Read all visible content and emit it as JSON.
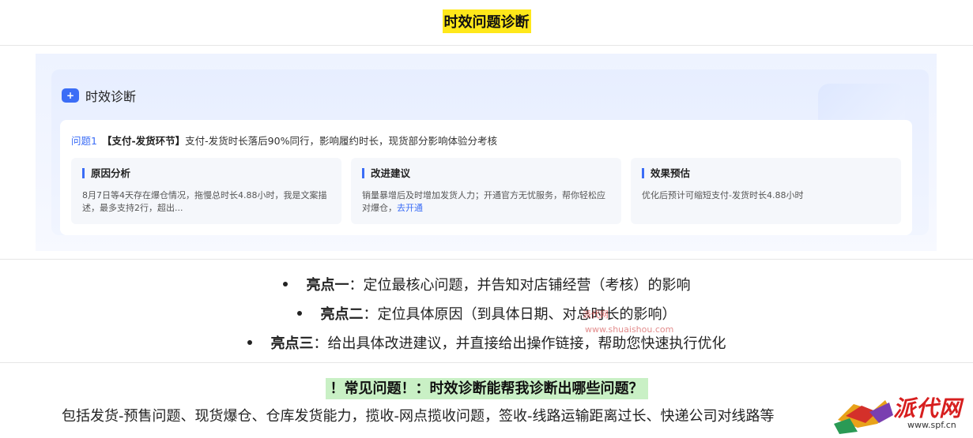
{
  "title": "时效问题诊断",
  "screenshot": {
    "card_title": "时效诊断",
    "card_icon": "+",
    "issue_number": "问题1",
    "issue_tag": "【支付-发货环节】",
    "issue_text": "支付-发货时长落后90%同行，影响履约时长，现货部分影响体验分考核",
    "cards": [
      {
        "title": "原因分析",
        "body": "8月7日等4天存在爆仓情况，拖慢总时长4.88小时，我是文案描述，最多支持2行，超出...",
        "link": ""
      },
      {
        "title": "改进建议",
        "body": "销量暴增后及时增加发货人力；开通官方无忧服务，帮你轻松应对爆仓，",
        "link": "去开通"
      },
      {
        "title": "效果预估",
        "body": "优化后预计可缩短支付-发货时长4.88小时",
        "link": ""
      }
    ]
  },
  "highlights": [
    {
      "label": "亮点一",
      "text": "：定位最核心问题，并告知对店铺经营（考核）的影响"
    },
    {
      "label": "亮点二",
      "text": "：定位具体原因（到具体日期、对总时长的影响）"
    },
    {
      "label": "亮点三",
      "text": "：给出具体改进建议，并直接给出操作链接，帮助您快速执行优化"
    }
  ],
  "watermark": {
    "cn": "派代网",
    "url": "www.shuaishou.com"
  },
  "faq": {
    "question": "！常见问题！：时效诊断能帮我诊断出哪些问题？",
    "answer": "包括发货-预售问题、现货爆仓、仓库发货能力，揽收-网点揽收问题，签收-线路运输距离过长、快递公司对线路等"
  },
  "logo": {
    "text": "派代网",
    "url": "www.spf.cn"
  }
}
